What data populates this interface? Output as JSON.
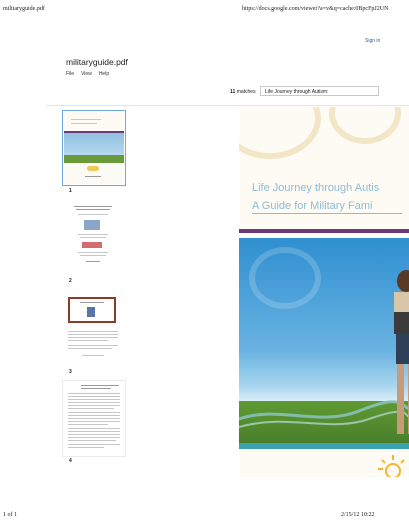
{
  "print": {
    "header_left": "militaryguide.pdf",
    "header_right": "https://docs.google.com/viewer?a=v&q=cache:0BpcFpJ2UN",
    "footer_left": "1 of 1",
    "footer_right": "2/15/12 10:22"
  },
  "viewer": {
    "sign_in": "Sign in",
    "title": "militaryguide.pdf",
    "menu": [
      "File",
      "View",
      "Help"
    ],
    "matches_count": "11",
    "matches_label": "matches",
    "search_value": "Life Journey through Autism:"
  },
  "thumbnails": [
    {
      "page": "1",
      "selected": true
    },
    {
      "page": "2",
      "selected": false
    },
    {
      "page": "3",
      "selected": false
    },
    {
      "page": "4",
      "selected": false
    }
  ],
  "main_page": {
    "title_line1": "Life Journey through Autis",
    "title_line2": "A Guide for Military Fami"
  },
  "colors": {
    "purple_band": "#6b3a7a",
    "teal_band": "#3aa3b0",
    "title_blue": "#8bbdd9",
    "selection": "#6fa8dc",
    "link": "#2a5db0"
  }
}
